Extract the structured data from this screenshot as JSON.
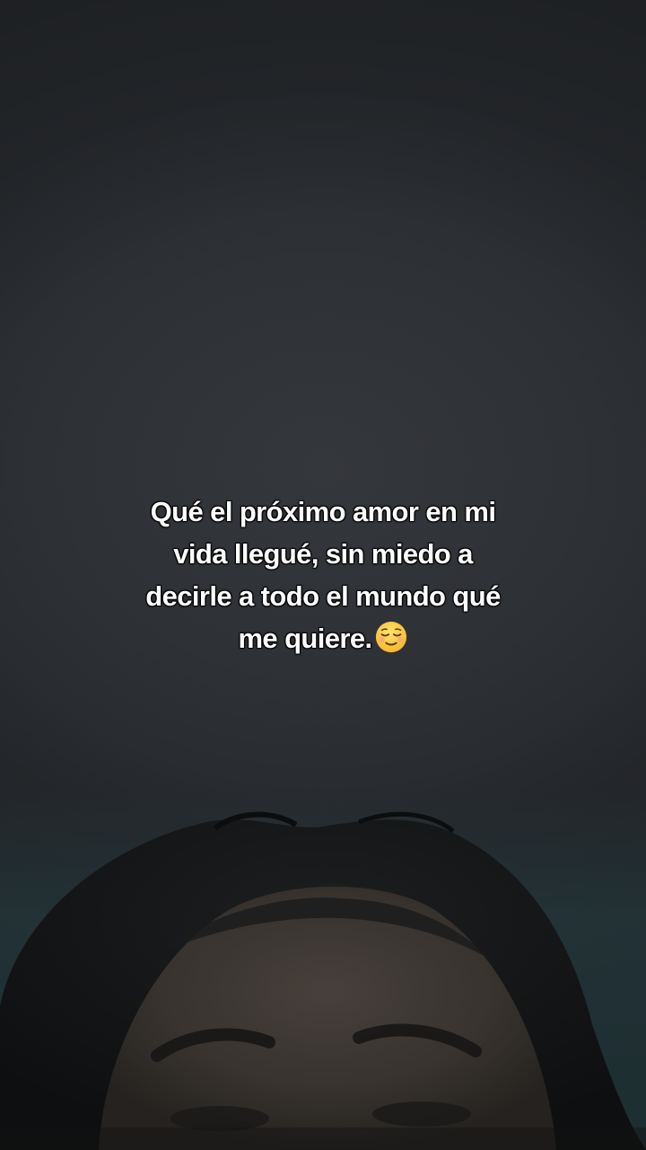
{
  "caption": {
    "line1": "Qué el próximo amor en mi",
    "line2": "vida llegué, sin miedo a",
    "line3": "decirle a todo el mundo qué",
    "line4": "me quiere."
  },
  "emoji": "relieved-face-emoji",
  "photo": {
    "subject": "head-top-selfie-icon",
    "colors": {
      "ceiling": "#2e3136",
      "hair": "#141516",
      "skin": "#3a3532",
      "curtain": "#2a4246",
      "text": "#ffffff"
    }
  }
}
